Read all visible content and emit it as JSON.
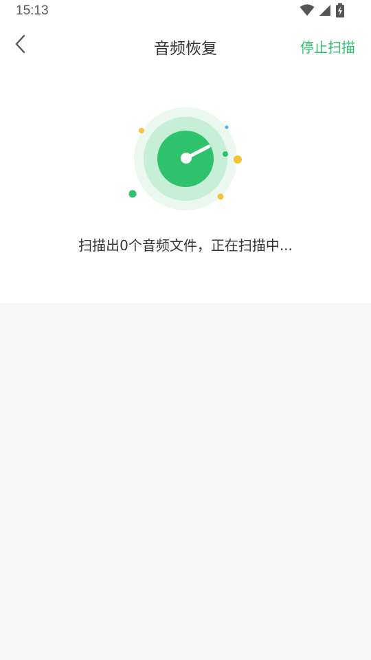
{
  "status_bar": {
    "time": "15:13",
    "icons": [
      "wifi-icon",
      "cell-signal-icon",
      "battery-charging-icon"
    ]
  },
  "toolbar": {
    "back_icon": "chevron-left-icon",
    "title": "音频恢复",
    "stop_label": "停止扫描"
  },
  "scan": {
    "status_text": "扫描出0个音频文件，正在扫描中..."
  },
  "colors": {
    "accent": "#2dc26b",
    "ring_outer": "#eaf8ef",
    "ring_middle": "#c6efd6",
    "dot_yellow": "#f6c33a",
    "dot_blue": "#4ab3ee",
    "background": "#f7f7f7"
  }
}
